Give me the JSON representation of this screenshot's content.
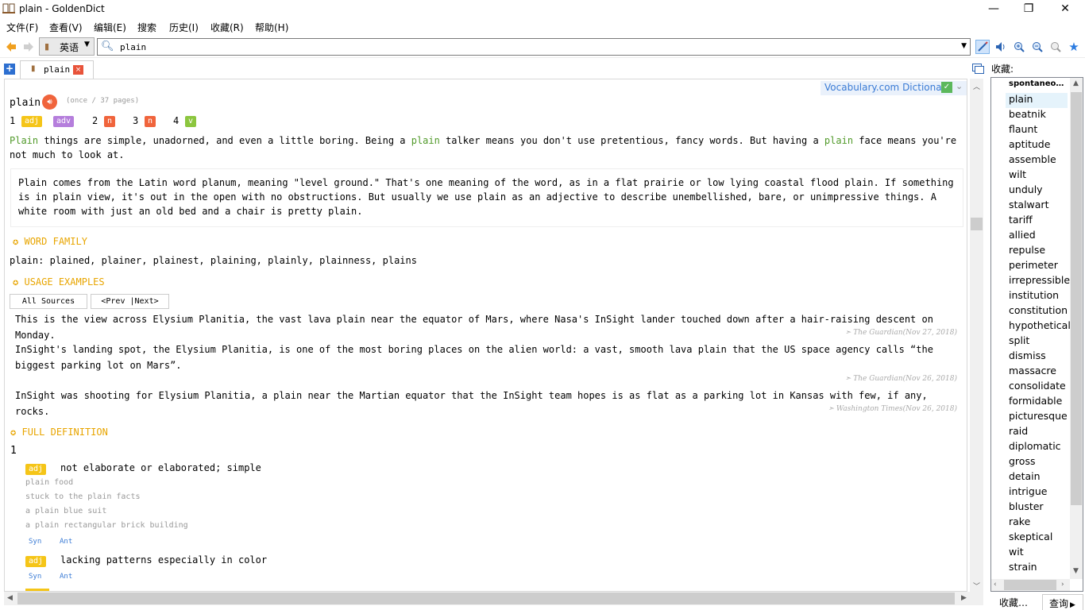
{
  "window": {
    "title": "plain - GoldenDict",
    "minimize_glyph": "—",
    "restore_glyph": "❐",
    "close_glyph": "✕"
  },
  "menu": {
    "items": [
      "文件(F)",
      "查看(V)",
      "编辑(E)",
      "搜索",
      "历史(I)",
      "收藏(R)",
      "帮助(H)"
    ]
  },
  "toolbar": {
    "group_label": "英语",
    "search_value": "plain",
    "search_placeholder": ""
  },
  "tabs": [
    {
      "label": "plain",
      "close": "×"
    }
  ],
  "article": {
    "dictionary_badge": "Vocabulary.com Dictionary",
    "word": "plain",
    "frequency": "(once / 37 pages)",
    "senses_row": [
      {
        "num": "1",
        "pos": [
          "adj",
          "adv"
        ]
      },
      {
        "num": "2",
        "pos": [
          "n"
        ]
      },
      {
        "num": "3",
        "pos": [
          "n"
        ]
      },
      {
        "num": "4",
        "pos": [
          "v"
        ]
      }
    ],
    "short_parts": [
      "Plain",
      " things are simple, unadorned, and even a little boring. Being a ",
      "plain",
      " talker means you don't use pretentious, fancy words. But having a ",
      "plain",
      " face means you're not much to look at."
    ],
    "long_text": "Plain comes from the Latin word planum, meaning \"level ground.\" That's one meaning of the word, as in a flat prairie or low lying coastal flood plain. If something is in plain view, it's out in the open with no obstructions. But usually we use plain as an adjective to describe unembellished, bare, or unimpressive things. A white room with just an old bed and a chair is pretty plain.",
    "word_family_heading": "WORD FAMILY",
    "word_family_word": "plain:",
    "word_family_forms": "plained, plainer, plainest, plaining, plainly, plainness, plains",
    "usage_heading": "USAGE EXAMPLES",
    "all_sources": "All Sources",
    "prev_next": "<Prev |Next>",
    "examples": [
      {
        "text": "This is the view across Elysium Planitia, the vast lava plain near the equator of Mars, where Nasa's InSight lander touched down after a hair-raising descent on Monday.",
        "source": "➣ The Guardian(Nov 27, 2018)"
      },
      {
        "text": "InSight's landing spot, the Elysium Planitia, is one of the most boring places on the alien world: a vast, smooth lava plain that the US space agency calls “the biggest parking lot on Mars”.",
        "source": "➣ The Guardian(Nov 26, 2018)"
      },
      {
        "text": "InSight was shooting for Elysium Planitia, a plain near the Martian equator that the InSight team hopes is as flat as a parking lot in Kansas with few, if any, rocks.",
        "source": "➣ Washington Times(Nov 26, 2018)"
      }
    ],
    "full_def_heading": "FULL DEFINITION",
    "full_def_num": "1",
    "definitions": [
      {
        "pos": "adj",
        "text": "not elaborate or elaborated; simple",
        "examples": [
          "plain food",
          "stuck to the plain facts",
          "a plain blue suit",
          "a plain rectangular brick building"
        ],
        "syn": "Syn",
        "ant": "Ant"
      },
      {
        "pos": "adj",
        "text": "lacking patterns especially in color",
        "syn": "Syn",
        "ant": "Ant"
      }
    ],
    "colors": {
      "adj": "#f5c518",
      "adv": "#b57edc",
      "n": "#f0643c",
      "v": "#8cc63f",
      "heading": "#e8a500",
      "highlight": "#519a2a"
    }
  },
  "favorites": {
    "header": "收藏:",
    "items": [
      "spontaneo…",
      "plain",
      "beatnik",
      "flaunt",
      "aptitude",
      "assemble",
      "wilt",
      "unduly",
      "stalwart",
      "tariff",
      "allied",
      "repulse",
      "perimeter",
      "irrepressible",
      "institution",
      "constitution",
      "hypothetical",
      "split",
      "dismiss",
      "massacre",
      "consolidate",
      "formidable",
      "picturesque",
      "raid",
      "diplomatic",
      "gross",
      "detain",
      "intrigue",
      "bluster",
      "rake",
      "skeptical",
      "wit",
      "strain"
    ],
    "selected": "plain",
    "bottom_tabs": [
      "收藏…",
      "查询"
    ]
  }
}
